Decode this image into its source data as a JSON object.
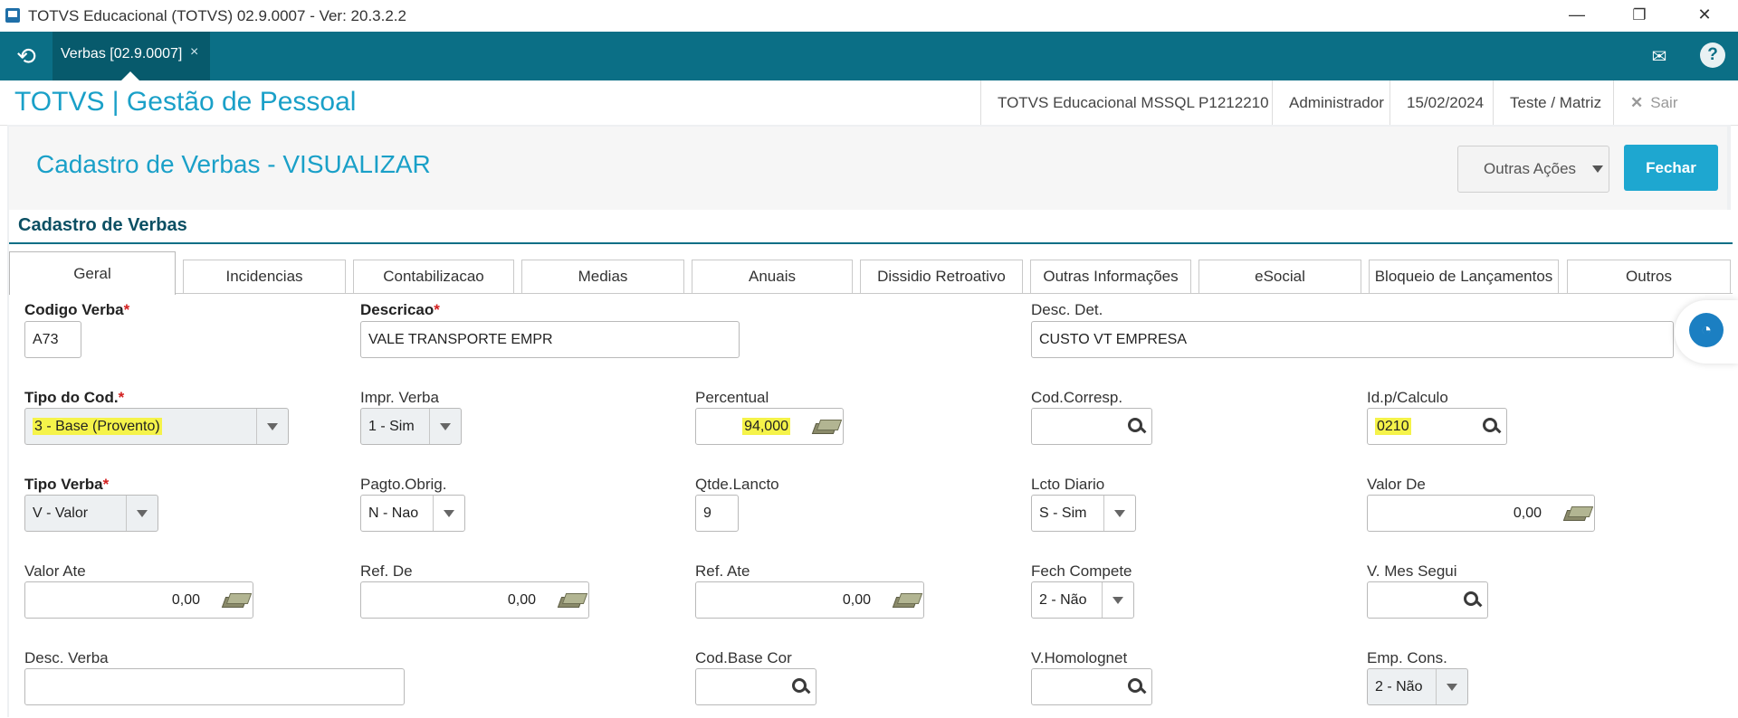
{
  "window": {
    "title": "TOTVS Educacional (TOTVS) 02.9.0007 - Ver: 20.3.2.2",
    "minimize": "—",
    "maximize": "❐",
    "close": "✕"
  },
  "tabbar": {
    "tab_label": "Verbas [02.9.0007]",
    "tab_close": "×",
    "home_icon": "⟲",
    "mail_icon": "✉",
    "help_icon": "?"
  },
  "header": {
    "brand": "TOTVS | Gestão de Pessoal",
    "environment": "TOTVS Educacional MSSQL P1212210",
    "user": "Administrador",
    "date": "15/02/2024",
    "branch": "Teste / Matriz",
    "exit_label": "Sair"
  },
  "page": {
    "title": "Cadastro de Verbas - VISUALIZAR",
    "other_actions": "Outras Ações",
    "close_button": "Fechar",
    "section_title": "Cadastro de Verbas"
  },
  "tabs": [
    "Geral",
    "Incidencias",
    "Contabilizacao",
    "Medias",
    "Anuais",
    "Dissidio Retroativo",
    "Outras Informações",
    "eSocial",
    "Bloqueio de Lançamentos",
    "Outros"
  ],
  "fields": {
    "codigo_verba": {
      "label": "Codigo Verba",
      "required": "*",
      "value": "A73"
    },
    "descricao": {
      "label": "Descricao",
      "required": "*",
      "value": "VALE TRANSPORTE EMPR"
    },
    "desc_det": {
      "label": "Desc. Det.",
      "value": "CUSTO VT EMPRESA"
    },
    "tipo_cod": {
      "label": "Tipo do Cod.",
      "required": "*",
      "value": "3 - Base (Provento)"
    },
    "impr_verba": {
      "label": "Impr. Verba",
      "value": "1 - Sim"
    },
    "percentual": {
      "label": "Percentual",
      "value": "94,000"
    },
    "cod_corresp": {
      "label": "Cod.Corresp.",
      "value": ""
    },
    "id_calculo": {
      "label": "Id.p/Calculo",
      "value": "0210"
    },
    "tipo_verba": {
      "label": "Tipo Verba",
      "required": "*",
      "value": "V - Valor"
    },
    "pagto_obrig": {
      "label": "Pagto.Obrig.",
      "value": "N - Nao"
    },
    "qtde_lancto": {
      "label": "Qtde.Lancto",
      "value": "9"
    },
    "lcto_diario": {
      "label": "Lcto Diario",
      "value": "S - Sim"
    },
    "valor_de": {
      "label": "Valor De",
      "value": "0,00"
    },
    "valor_ate": {
      "label": "Valor Ate",
      "value": "0,00"
    },
    "ref_de": {
      "label": "Ref. De",
      "value": "0,00"
    },
    "ref_ate": {
      "label": "Ref. Ate",
      "value": "0,00"
    },
    "fech_compete": {
      "label": "Fech Compete",
      "value": "2 - Não"
    },
    "v_mes_segui": {
      "label": "V. Mes Segui",
      "value": ""
    },
    "desc_verba": {
      "label": "Desc. Verba",
      "value": ""
    },
    "cod_base_cor": {
      "label": "Cod.Base Cor",
      "value": ""
    },
    "v_homolognet": {
      "label": "V.Homolognet",
      "value": ""
    },
    "emp_cons": {
      "label": "Emp. Cons.",
      "value": "2 - Não"
    }
  },
  "colors": {
    "teal": "#0b6f86",
    "accent_blue": "#1aa0c8",
    "highlight": "#f5f34a",
    "required_star": "#d21e1e"
  }
}
